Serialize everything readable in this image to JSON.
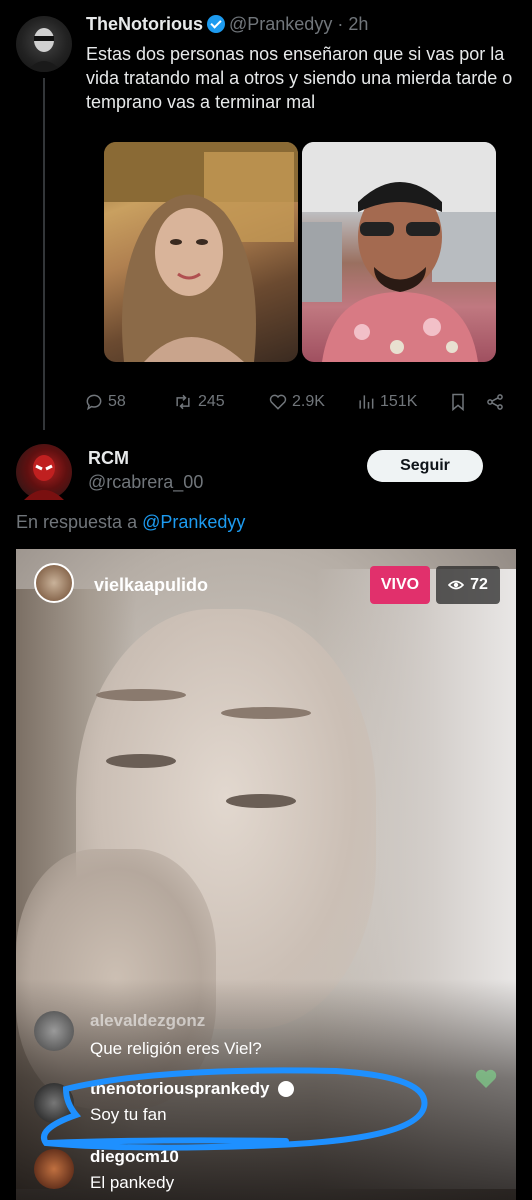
{
  "tweet": {
    "author_name": "TheNotorious",
    "author_handle": "@Prankedyy",
    "separator": "·",
    "time": "2h",
    "text": "Estas dos personas nos enseñaron que si vas por la vida tratando mal a otros y siendo una mierda tarde o temprano vas a terminar mal",
    "actions": {
      "replies": "58",
      "retweets": "245",
      "likes": "2.9K",
      "views": "151K"
    }
  },
  "reply": {
    "author_name": "RCM",
    "author_handle": "@rcabrera_00",
    "follow_label": "Seguir",
    "replying_to_prefix": "En respuesta a",
    "replying_to_handle": "@Prankedyy"
  },
  "live": {
    "username": "vielkaapulido",
    "live_badge": "VIVO",
    "viewer_count": "72",
    "comments": [
      {
        "user": "alevaldezgonz",
        "text": "Que religión eres Viel?"
      },
      {
        "user": "thenotoriousprankedy",
        "text": "Soy tu fan"
      },
      {
        "user": "diegocm10",
        "text": "El pankedy"
      }
    ]
  },
  "colors": {
    "accent": "#1d9bf0",
    "live_badge": "#e1306c",
    "annotation": "#1e90ff"
  },
  "icons": [
    "reply-icon",
    "retweet-icon",
    "like-icon",
    "views-icon",
    "bookmark-icon",
    "share-icon",
    "verified-icon",
    "eye-icon",
    "heart-icon"
  ]
}
